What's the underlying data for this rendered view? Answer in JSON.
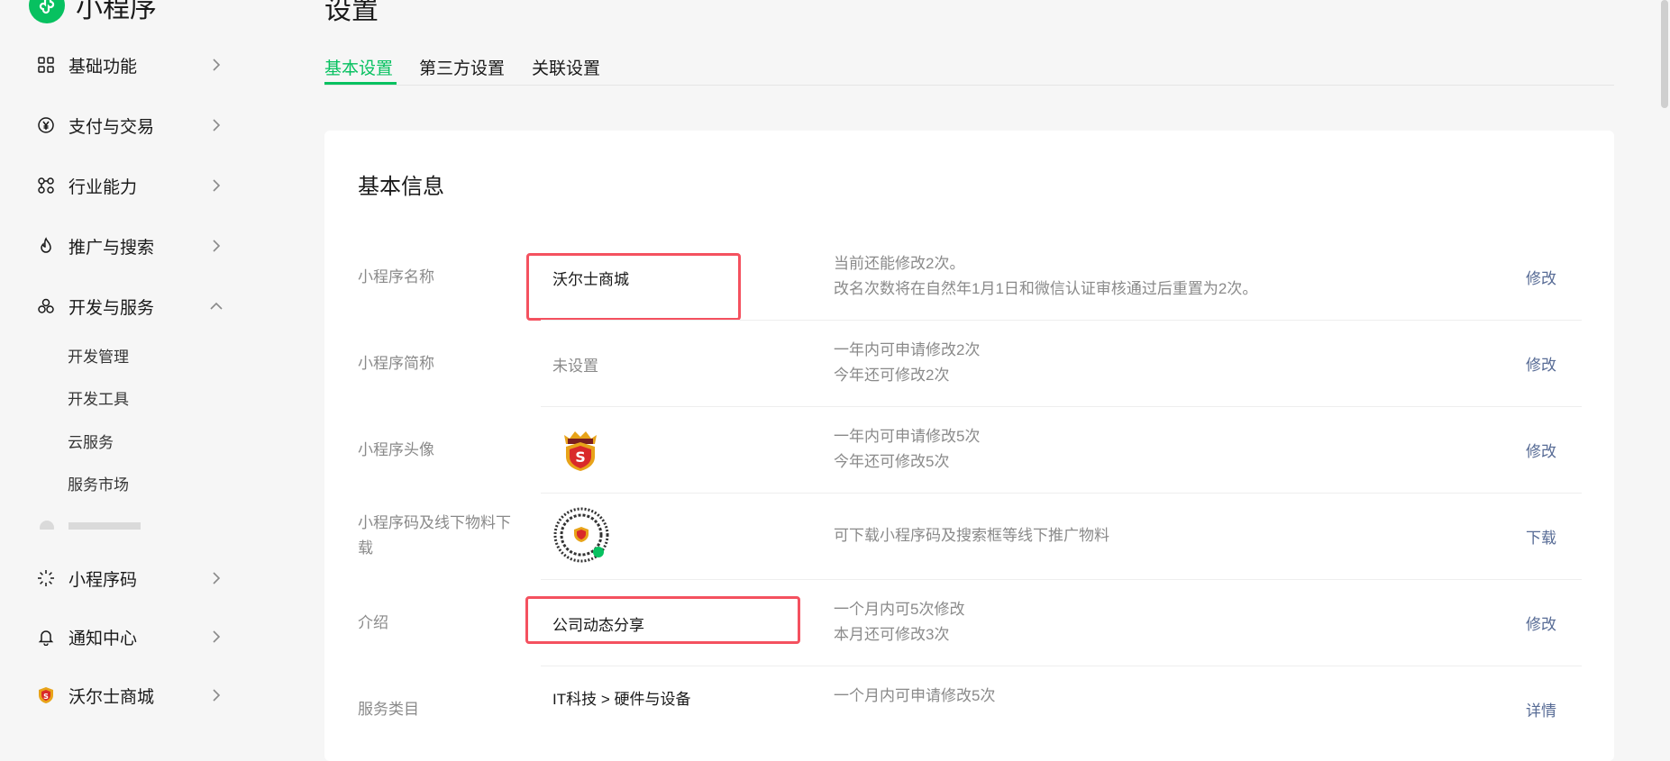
{
  "app": {
    "name": "小程序"
  },
  "sidebar": {
    "items": [
      {
        "label": "基础功能",
        "icon": "grid-icon"
      },
      {
        "label": "支付与交易",
        "icon": "yen-circle-icon"
      },
      {
        "label": "行业能力",
        "icon": "nodes-icon"
      },
      {
        "label": "推广与搜索",
        "icon": "flame-icon"
      },
      {
        "label": "开发与服务",
        "icon": "cluster-icon",
        "expanded": true
      }
    ],
    "subitems": [
      "开发管理",
      "开发工具",
      "云服务",
      "服务市场"
    ],
    "bottom": [
      {
        "label": "小程序码",
        "icon": "qr-burst-icon"
      },
      {
        "label": "通知中心",
        "icon": "bell-icon"
      },
      {
        "label": "沃尔士商城",
        "icon": "shield-logo-icon"
      }
    ]
  },
  "page": {
    "title": "设置"
  },
  "tabs": [
    "基本设置",
    "第三方设置",
    "关联设置"
  ],
  "card": {
    "title": "基本信息",
    "rows": [
      {
        "label": "小程序名称",
        "value": "沃尔士商城",
        "desc1": "当前还能修改2次。",
        "desc2": "改名次数将在自然年1月1日和微信认证审核通过后重置为2次。",
        "action": "修改"
      },
      {
        "label": "小程序简称",
        "value": "未设置",
        "desc1": "一年内可申请修改2次",
        "desc2": "今年还可修改2次",
        "action": "修改"
      },
      {
        "label": "小程序头像",
        "desc1": "一年内可申请修改5次",
        "desc2": "今年还可修改5次",
        "action": "修改"
      },
      {
        "label1": "小程序码及线下物料下",
        "label2": "载",
        "desc1": "可下载小程序码及搜索框等线下推广物料",
        "action": "下载"
      },
      {
        "label": "介绍",
        "value": "公司动态分享",
        "desc1": "一个月内可5次修改",
        "desc2": "本月还可修改3次",
        "action": "修改"
      },
      {
        "label": "服务类目",
        "value": "IT科技 > 硬件与设备",
        "desc1": "一个月内可申请修改5次",
        "action": "详情"
      }
    ]
  },
  "colors": {
    "accent": "#07c160",
    "link": "#576b95",
    "highlight": "#f4515f",
    "muted": "#8a8a8a"
  }
}
